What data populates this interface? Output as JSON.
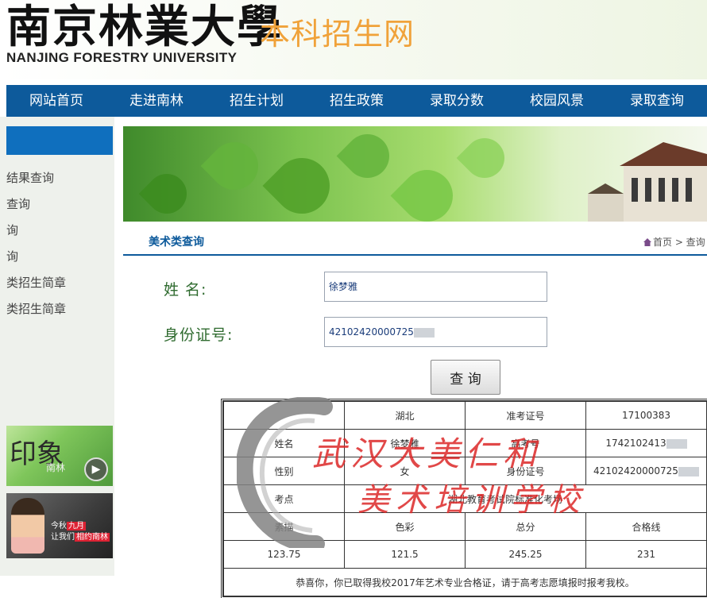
{
  "header": {
    "logo_cn": "南京林業大學",
    "logo_en": "NANJING FORESTRY UNIVERSITY",
    "site_title": "本科招生网"
  },
  "nav": [
    {
      "label": "网站首页"
    },
    {
      "label": "走进南林"
    },
    {
      "label": "招生计划"
    },
    {
      "label": "招生政策"
    },
    {
      "label": "录取分数"
    },
    {
      "label": "校园风景"
    },
    {
      "label": "录取查询"
    }
  ],
  "sidebar": {
    "items": [
      {
        "label": "结果查询"
      },
      {
        "label": "查询"
      },
      {
        "label": "询"
      },
      {
        "label": "询"
      },
      {
        "label": "类招生简章"
      },
      {
        "label": "类招生简章"
      }
    ],
    "ad1_text": "印象",
    "ad1_sub": "南林",
    "ad2_line1_prefix": "今秋",
    "ad2_line1_hl": "九月",
    "ad2_line2_prefix": "让我们",
    "ad2_line2_hl": "相约南林"
  },
  "page": {
    "section_title": "美术类查询",
    "breadcrumb": "首页 > 查询"
  },
  "form": {
    "name_label": "姓      名:",
    "name_value": "徐梦雅",
    "id_label": "身份证号:",
    "id_value": "42102420000725",
    "query_button": "查 询"
  },
  "results": {
    "row1": [
      "",
      "湖北",
      "准考证号",
      "17100383"
    ],
    "row2": [
      "姓名",
      "徐梦雅",
      "高考号",
      "1742102413"
    ],
    "row3": [
      "性别",
      "女",
      "身份证号",
      "42102420000725"
    ],
    "row4": [
      "考点",
      "湖北教育考试院标准化考场",
      "",
      ""
    ],
    "row5": [
      "素描",
      "色彩",
      "总分",
      "合格线"
    ],
    "row6": [
      "123.75",
      "121.5",
      "245.25",
      "231"
    ],
    "notice": "恭喜你，你已取得我校2017年艺术专业合格证，请于高考志愿填报时报考我校。"
  },
  "watermark": {
    "line1": "武汉大美仁和",
    "line2": "美术培训学校"
  },
  "colors": {
    "nav_bg": "#0d5a9b",
    "title_orange": "#f0a23a",
    "label_green": "#2f6b2f",
    "notice_red": "#c01818"
  }
}
